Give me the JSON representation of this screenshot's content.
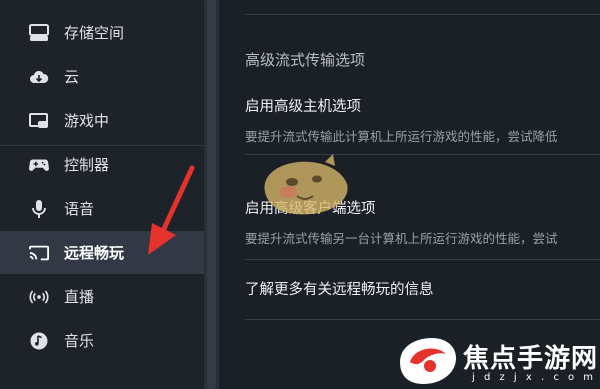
{
  "sidebar": {
    "items": [
      {
        "label": "存储空间",
        "icon": "storage-icon"
      },
      {
        "label": "云",
        "icon": "cloud-icon"
      },
      {
        "label": "游戏中",
        "icon": "in-game-icon"
      },
      {
        "label": "控制器",
        "icon": "controller-icon"
      },
      {
        "label": "语音",
        "icon": "microphone-icon"
      },
      {
        "label": "远程畅玩",
        "icon": "cast-icon",
        "active": true
      },
      {
        "label": "直播",
        "icon": "broadcast-icon"
      },
      {
        "label": "音乐",
        "icon": "music-icon"
      }
    ]
  },
  "main": {
    "section_title": "高级流式传输选项",
    "host_option": {
      "title": "启用高级主机选项",
      "description": "要提升流式传输此计算机上所运行游戏的性能，尝试降低"
    },
    "client_option": {
      "title": "启用高级客户端选项",
      "description": "要提升流式传输另一台计算机上所运行游戏的性能，尝试"
    },
    "learn_more": "了解更多有关远程畅玩的信息"
  },
  "watermark": {
    "title": "焦点手游网",
    "url": "j d z j x . c o m"
  },
  "colors": {
    "accent_arrow": "#e5322d",
    "active_bg": "#323844"
  }
}
